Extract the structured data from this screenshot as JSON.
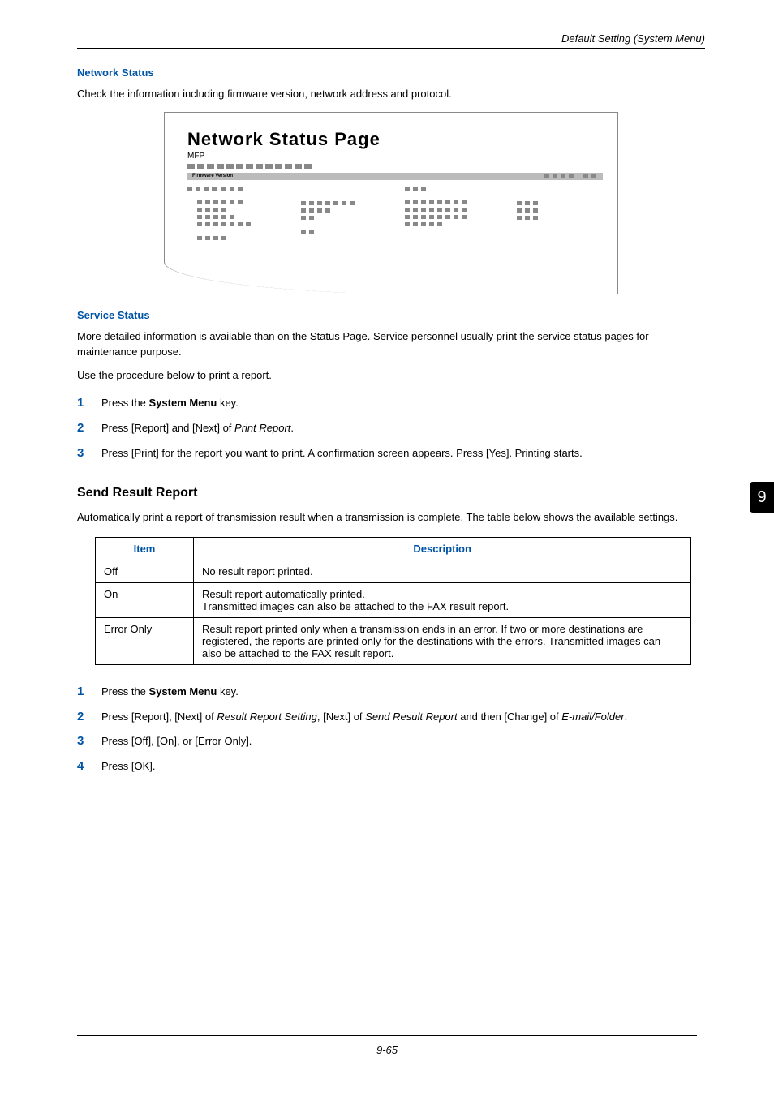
{
  "header": {
    "section": "Default Setting (System Menu)"
  },
  "sidebar": {
    "chapter": "9"
  },
  "network_status": {
    "heading": "Network Status",
    "desc": "Check the information including firmware version, network address and protocol.",
    "illustration": {
      "title": "Network Status Page",
      "subtitle": "MFP",
      "firm_label": "Firmware Version"
    }
  },
  "service_status": {
    "heading": "Service Status",
    "desc": "More detailed information is available than on the Status Page. Service personnel usually print the service status pages for maintenance purpose.",
    "lead": "Use the procedure below to print a report.",
    "steps": [
      {
        "n": "1",
        "html": "Press the <b>System Menu</b> key."
      },
      {
        "n": "2",
        "html": "Press [Report] and [Next] of <i>Print Report</i>."
      },
      {
        "n": "3",
        "html": "Press [Print] for the report you want to print. A confirmation screen appears. Press [Yes]. Printing starts."
      }
    ]
  },
  "send_result": {
    "heading": "Send Result Report",
    "desc": "Automatically print a report of transmission result when a transmission is complete. The table below shows the available settings.",
    "table": {
      "headers": [
        "Item",
        "Description"
      ],
      "rows": [
        {
          "item": "Off",
          "desc": "No result report printed."
        },
        {
          "item": "On",
          "desc": "Result report automatically printed.\nTransmitted images can also be attached to the FAX result report."
        },
        {
          "item": "Error Only",
          "desc": "Result report printed only when a transmission ends in an error. If two or more destinations are registered, the reports are printed only for the destinations with the errors. Transmitted images can also be attached to the FAX result report."
        }
      ]
    },
    "steps": [
      {
        "n": "1",
        "html": "Press the <b>System Menu</b> key."
      },
      {
        "n": "2",
        "html": "Press [Report], [Next] of <i>Result Report Setting</i>, [Next] of <i>Send Result Report</i> and then [Change] of <i>E-mail/Folder</i>."
      },
      {
        "n": "3",
        "html": "Press [Off], [On], or [Error Only]."
      },
      {
        "n": "4",
        "html": "Press [OK]."
      }
    ]
  },
  "footer": {
    "page": "9-65"
  }
}
